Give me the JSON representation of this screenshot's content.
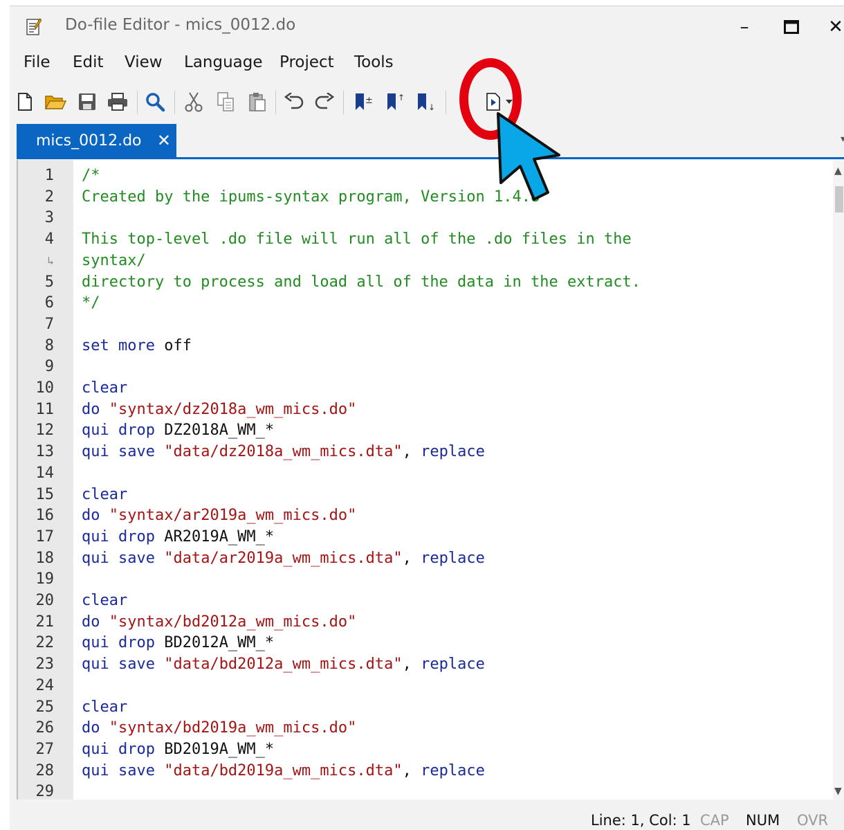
{
  "window": {
    "title": "Do-file Editor - mics_0012.do",
    "controls": {
      "minimize": "–",
      "maximize": "☐",
      "close": "✕"
    }
  },
  "menu": [
    "File",
    "Edit",
    "View",
    "Language",
    "Project",
    "Tools"
  ],
  "toolbar": {
    "icons": [
      "new-file-icon",
      "open-folder-icon",
      "save-icon",
      "print-icon",
      "find-icon",
      "cut-icon",
      "copy-icon",
      "paste-icon",
      "undo-icon",
      "redo-icon",
      "toggle-bookmark-icon",
      "previous-bookmark-icon",
      "next-bookmark-icon",
      "show-file-icon",
      "execute-do-icon",
      "execute-dropdown-icon"
    ]
  },
  "tab": {
    "label": "mics_0012.do",
    "close": "✕"
  },
  "editor": {
    "line_numbers": [
      "1",
      "2",
      "3",
      "4",
      "↳",
      "5",
      "6",
      "7",
      "8",
      "9",
      "10",
      "11",
      "12",
      "13",
      "14",
      "15",
      "16",
      "17",
      "18",
      "19",
      "20",
      "21",
      "22",
      "23",
      "24",
      "25",
      "26",
      "27",
      "28",
      "29"
    ],
    "lines": [
      [
        {
          "t": "/*",
          "c": "comment"
        }
      ],
      [
        {
          "t": "Created by the ipums-syntax program, Version 1.4.8",
          "c": "comment"
        }
      ],
      [],
      [
        {
          "t": "This top-level .do file will run all of the .do files in the",
          "c": "comment"
        }
      ],
      [
        {
          "t": "syntax/",
          "c": "comment"
        }
      ],
      [
        {
          "t": "directory to process and load all of the data in the extract.",
          "c": "comment"
        }
      ],
      [
        {
          "t": "*/",
          "c": "comment"
        }
      ],
      [],
      [
        {
          "t": "set more ",
          "c": "kw"
        },
        {
          "t": "off",
          "c": "plain"
        }
      ],
      [],
      [
        {
          "t": "clear",
          "c": "kw"
        }
      ],
      [
        {
          "t": "do ",
          "c": "kw"
        },
        {
          "t": "\"syntax/dz2018a_wm_mics.do\"",
          "c": "str"
        }
      ],
      [
        {
          "t": "qui drop ",
          "c": "kw"
        },
        {
          "t": "DZ2018A_WM_*",
          "c": "plain"
        }
      ],
      [
        {
          "t": "qui save ",
          "c": "kw"
        },
        {
          "t": "\"data/dz2018a_wm_mics.dta\"",
          "c": "str"
        },
        {
          "t": ", ",
          "c": "plain"
        },
        {
          "t": "replace",
          "c": "kw"
        }
      ],
      [],
      [
        {
          "t": "clear",
          "c": "kw"
        }
      ],
      [
        {
          "t": "do ",
          "c": "kw"
        },
        {
          "t": "\"syntax/ar2019a_wm_mics.do\"",
          "c": "str"
        }
      ],
      [
        {
          "t": "qui drop ",
          "c": "kw"
        },
        {
          "t": "AR2019A_WM_*",
          "c": "plain"
        }
      ],
      [
        {
          "t": "qui save ",
          "c": "kw"
        },
        {
          "t": "\"data/ar2019a_wm_mics.dta\"",
          "c": "str"
        },
        {
          "t": ", ",
          "c": "plain"
        },
        {
          "t": "replace",
          "c": "kw"
        }
      ],
      [],
      [
        {
          "t": "clear",
          "c": "kw"
        }
      ],
      [
        {
          "t": "do ",
          "c": "kw"
        },
        {
          "t": "\"syntax/bd2012a_wm_mics.do\"",
          "c": "str"
        }
      ],
      [
        {
          "t": "qui drop ",
          "c": "kw"
        },
        {
          "t": "BD2012A_WM_*",
          "c": "plain"
        }
      ],
      [
        {
          "t": "qui save ",
          "c": "kw"
        },
        {
          "t": "\"data/bd2012a_wm_mics.dta\"",
          "c": "str"
        },
        {
          "t": ", ",
          "c": "plain"
        },
        {
          "t": "replace",
          "c": "kw"
        }
      ],
      [],
      [
        {
          "t": "clear",
          "c": "kw"
        }
      ],
      [
        {
          "t": "do ",
          "c": "kw"
        },
        {
          "t": "\"syntax/bd2019a_wm_mics.do\"",
          "c": "str"
        }
      ],
      [
        {
          "t": "qui drop ",
          "c": "kw"
        },
        {
          "t": "BD2019A_WM_*",
          "c": "plain"
        }
      ],
      [
        {
          "t": "qui save ",
          "c": "kw"
        },
        {
          "t": "\"data/bd2019a_wm_mics.dta\"",
          "c": "str"
        },
        {
          "t": ", ",
          "c": "plain"
        },
        {
          "t": "replace",
          "c": "kw"
        }
      ],
      []
    ]
  },
  "status": {
    "position": "Line: 1, Col: 1",
    "cap": "CAP",
    "num": "NUM",
    "ovr": "OVR"
  },
  "colors": {
    "accent": "#0a66c2",
    "comment": "#228b22",
    "keyword": "#1a2a9a",
    "string": "#a31515",
    "annotation_ring": "#e3000f",
    "annotation_cursor": "#0aa7e8"
  }
}
